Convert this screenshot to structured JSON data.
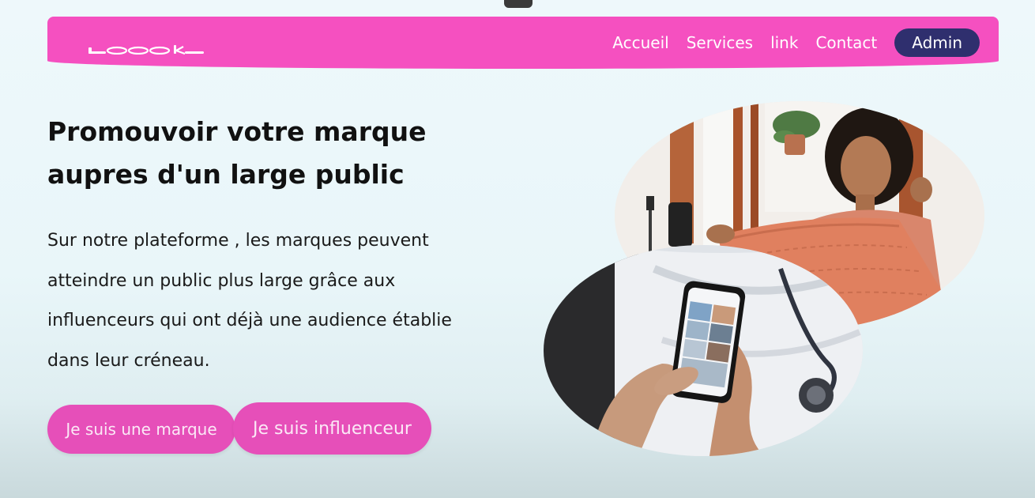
{
  "nav": {
    "logo_alt": "Look",
    "links": [
      "Accueil",
      "Services",
      "link",
      "Contact"
    ],
    "admin_label": "Admin"
  },
  "hero": {
    "title": "Promouvoir votre marque aupres d'un large public",
    "description": "Sur notre plateforme , les marques peuvent atteindre un public plus large grâce aux influenceurs qui ont déjà une audience établie dans leur créneau.",
    "cta_brand": "Je suis une marque",
    "cta_influencer": "Je suis influenceur"
  },
  "colors": {
    "brand_pink": "#f550c0",
    "button_pink": "#e64fb9",
    "admin_navy": "#2f2f6e"
  },
  "images": {
    "top": "woman-holding-knit-sweater-photo",
    "bottom": "hands-holding-smartphone-photo"
  }
}
